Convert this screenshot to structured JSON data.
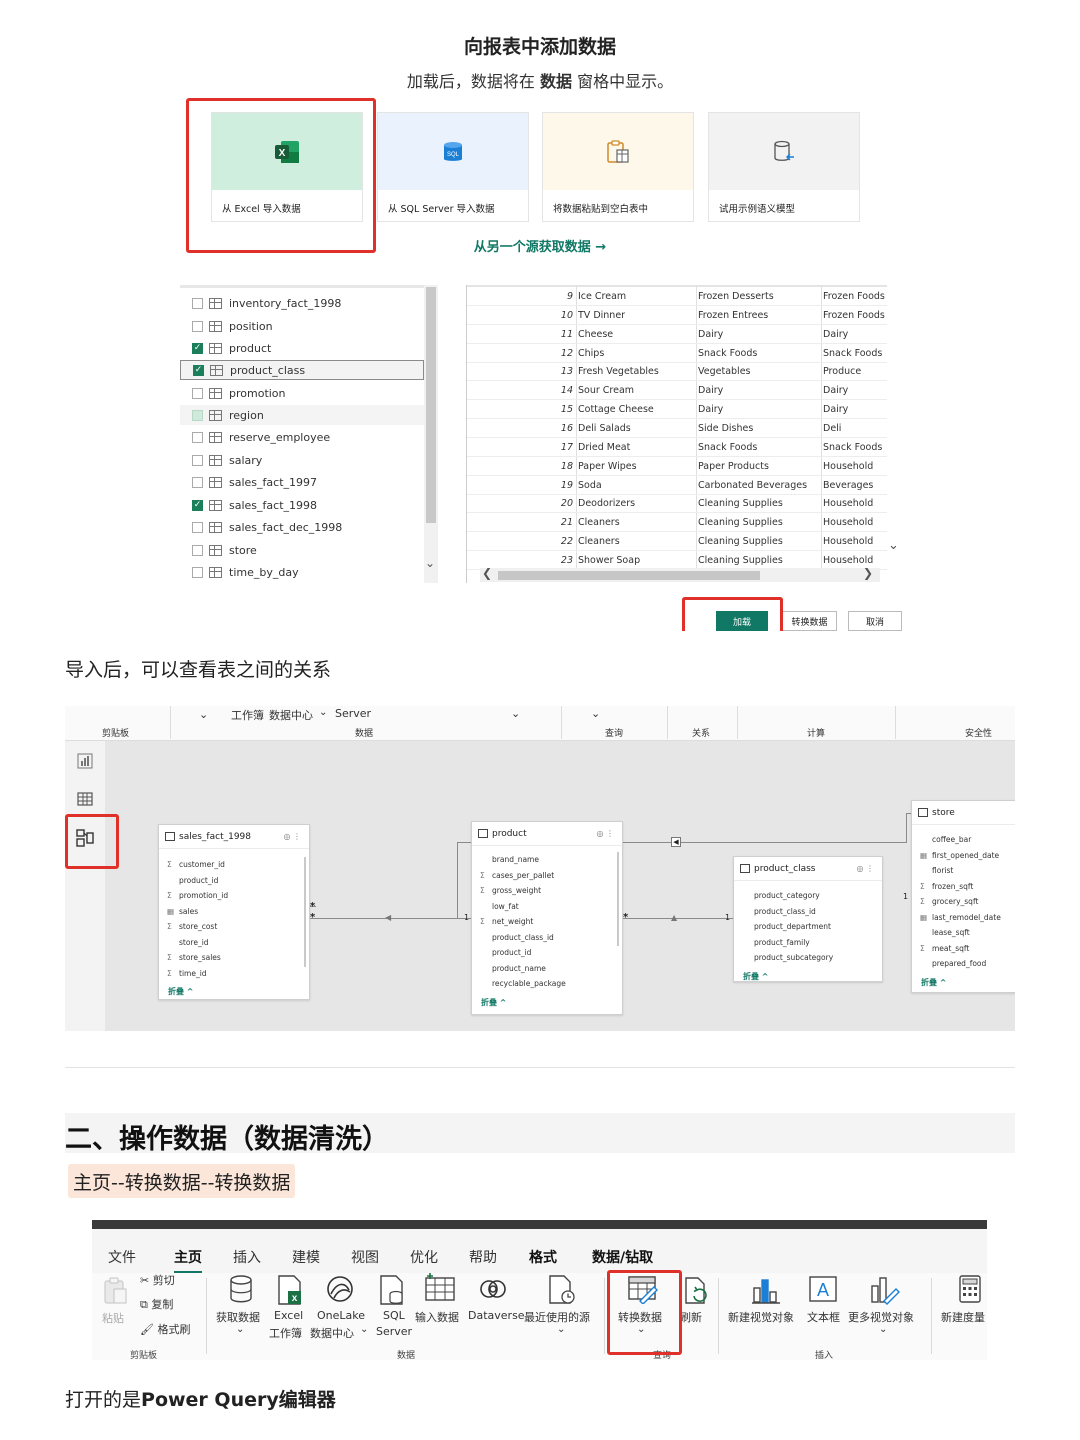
{
  "section1": {
    "title": "向报表中添加数据",
    "subtitle_pre": "加载后，数据将在",
    "subtitle_bold": "数据",
    "subtitle_post": "窗格中显示。",
    "cards": [
      {
        "label": "从 Excel 导入数据",
        "icon": "excel-icon",
        "color": "#cfeedd"
      },
      {
        "label": "从 SQL Server 导入数据",
        "icon": "sql-database-icon",
        "color": "#eaf3fd"
      },
      {
        "label": "将数据粘贴到空白表中",
        "icon": "paste-table-icon",
        "color": "#fdf8ea"
      },
      {
        "label": "试用示例语义模型",
        "icon": "sample-model-icon",
        "color": "#f2f2f2"
      }
    ],
    "other_source": "从另一个源获取数据 →",
    "navigator_items": [
      {
        "name": "inventory_fact_1998",
        "checked": "no"
      },
      {
        "name": "position",
        "checked": "no"
      },
      {
        "name": "product",
        "checked": "yes"
      },
      {
        "name": "product_class",
        "checked": "yes"
      },
      {
        "name": "promotion",
        "checked": "no"
      },
      {
        "name": "region",
        "checked": "half"
      },
      {
        "name": "reserve_employee",
        "checked": "no"
      },
      {
        "name": "salary",
        "checked": "no"
      },
      {
        "name": "sales_fact_1997",
        "checked": "no"
      },
      {
        "name": "sales_fact_1998",
        "checked": "yes"
      },
      {
        "name": "sales_fact_dec_1998",
        "checked": "no"
      },
      {
        "name": "store",
        "checked": "no"
      },
      {
        "name": "time_by_day",
        "checked": "no"
      }
    ],
    "preview_rows": [
      [
        "9",
        "Ice Cream",
        "Frozen Desserts",
        "Frozen Foods"
      ],
      [
        "10",
        "TV Dinner",
        "Frozen Entrees",
        "Frozen Foods"
      ],
      [
        "11",
        "Cheese",
        "Dairy",
        "Dairy"
      ],
      [
        "12",
        "Chips",
        "Snack Foods",
        "Snack Foods"
      ],
      [
        "13",
        "Fresh Vegetables",
        "Vegetables",
        "Produce"
      ],
      [
        "14",
        "Sour Cream",
        "Dairy",
        "Dairy"
      ],
      [
        "15",
        "Cottage Cheese",
        "Dairy",
        "Dairy"
      ],
      [
        "16",
        "Deli Salads",
        "Side Dishes",
        "Deli"
      ],
      [
        "17",
        "Dried Meat",
        "Snack Foods",
        "Snack Foods"
      ],
      [
        "18",
        "Paper Wipes",
        "Paper Products",
        "Household"
      ],
      [
        "19",
        "Soda",
        "Carbonated Beverages",
        "Beverages"
      ],
      [
        "20",
        "Deodorizers",
        "Cleaning Supplies",
        "Household"
      ],
      [
        "21",
        "Cleaners",
        "Cleaning Supplies",
        "Household"
      ],
      [
        "22",
        "Cleaners",
        "Cleaning Supplies",
        "Household"
      ],
      [
        "23",
        "Shower Soap",
        "Cleaning Supplies",
        "Household"
      ]
    ],
    "buttons": {
      "load": "加载",
      "transform": "转换数据",
      "cancel": "取消"
    }
  },
  "para1": "导入后，可以查看表之间的关系",
  "model": {
    "ribbon_top": {
      "workbook": "工作簿",
      "datahub": "数据中心",
      "server": "Server"
    },
    "groups": {
      "clipboard": "剪贴板",
      "data": "数据",
      "query": "查询",
      "relations": "关系",
      "calc": "计算",
      "security": "安全性"
    },
    "fold_label": "折叠 ^",
    "tables": {
      "sales": {
        "name": "sales_fact_1998",
        "fields": [
          "customer_id",
          "product_id",
          "promotion_id",
          "sales",
          "store_cost",
          "store_id",
          "store_sales",
          "time_id"
        ]
      },
      "product": {
        "name": "product",
        "fields": [
          "brand_name",
          "cases_per_pallet",
          "gross_weight",
          "low_fat",
          "net_weight",
          "product_class_id",
          "product_id",
          "product_name",
          "recyclable_package"
        ]
      },
      "product_class": {
        "name": "product_class",
        "fields": [
          "product_category",
          "product_class_id",
          "product_department",
          "product_family",
          "product_subcategory"
        ]
      },
      "store": {
        "name": "store",
        "fields": [
          "coffee_bar",
          "first_opened_date",
          "florist",
          "frozen_sqft",
          "grocery_sqft",
          "last_remodel_date",
          "lease_sqft",
          "meat_sqft",
          "prepared_food"
        ]
      }
    },
    "cardinality": {
      "many": "*",
      "one": "1"
    }
  },
  "section3": {
    "heading": "二、操作数据（数据清洗）",
    "breadcrumb": "主页--转换数据--转换数据",
    "tabs": [
      "文件",
      "主页",
      "插入",
      "建模",
      "视图",
      "优化",
      "帮助",
      "格式",
      "数据/钻取"
    ],
    "clipboard": {
      "paste": "粘贴",
      "cut": "剪切",
      "copy": "复制",
      "format_painter": "格式刷",
      "group": "剪贴板"
    },
    "data": {
      "get_data": "获取数据",
      "excel_1": "Excel",
      "excel_2": "工作簿",
      "onelake_1": "OneLake",
      "onelake_2": "数据中心",
      "sql_1": "SQL",
      "sql_2": "Server",
      "enter_data": "输入数据",
      "dataverse": "Dataverse",
      "recent": "最近使用的源",
      "group": "数据"
    },
    "query": {
      "transform": "转换数据",
      "refresh": "刷新",
      "group": "查询"
    },
    "insert": {
      "new_visual": "新建视觉对象",
      "textbox": "文本框",
      "more_visuals": "更多视觉对象",
      "group": "插入"
    },
    "calc": {
      "new_measure": "新建度量"
    }
  },
  "para3_pre": "打开的是",
  "para3_bold": "Power Query编辑器",
  "colors": {
    "accent": "#117865",
    "highlight": "#e0302a",
    "excel": "#1d7044"
  }
}
